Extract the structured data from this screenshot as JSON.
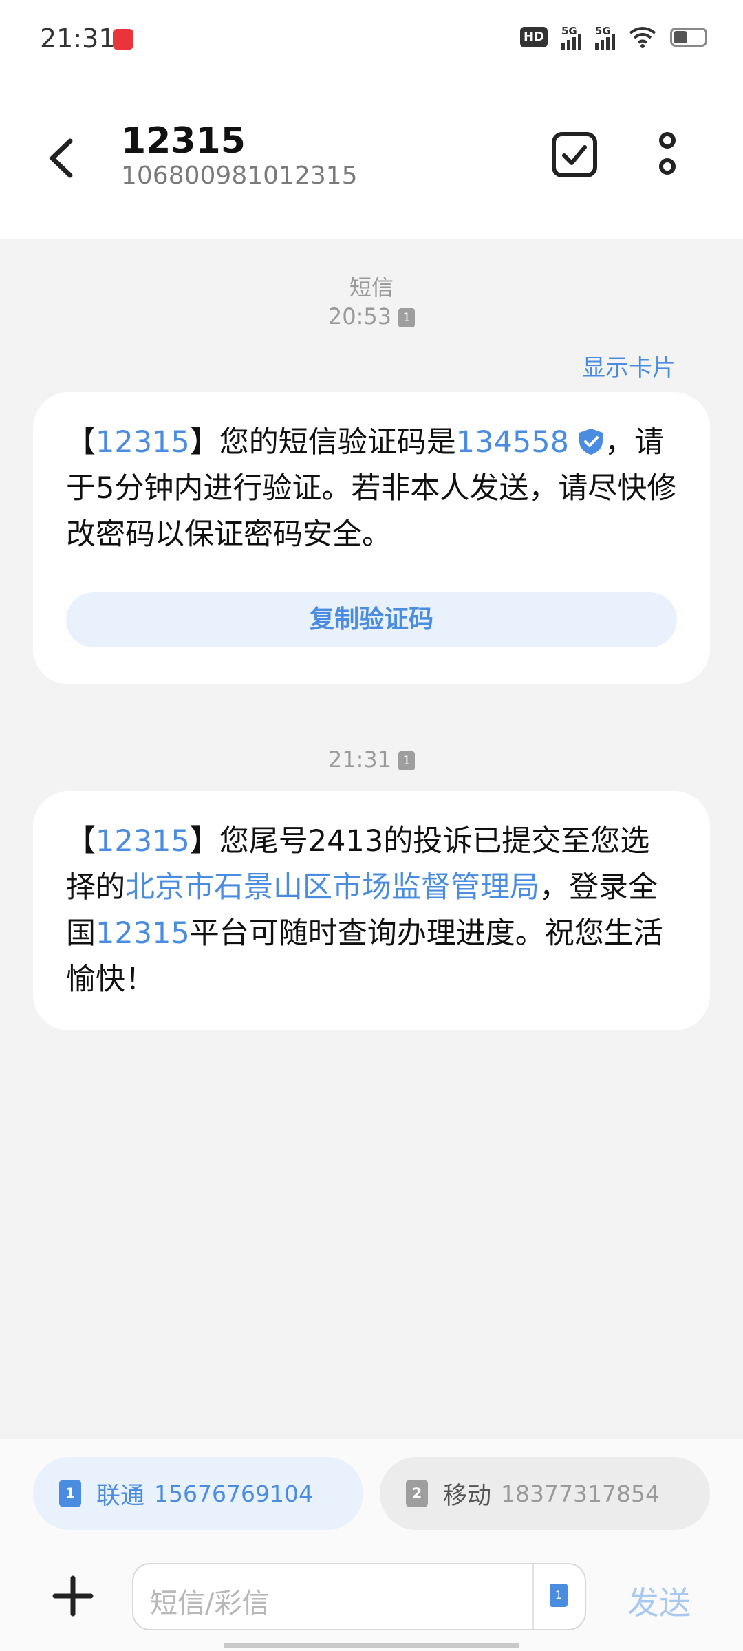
{
  "status": {
    "time": "21:31",
    "hd_label": "HD",
    "sim1_network": "5G",
    "sim2_network": "5G"
  },
  "header": {
    "contact_name": "12315",
    "contact_number": "106800981012315"
  },
  "thread": {
    "first_meta_label": "短信",
    "first_time": "20:53",
    "first_sim": "1",
    "show_card": "显示卡片",
    "message1": {
      "p1": "【",
      "link1": "12315",
      "p2": "】您的短信验证码是",
      "code": "134558",
      "p3": "，请于5分钟内进行验证。若非本人发送，请尽快修改密码以保证密码安全。",
      "copy_button": "复制验证码"
    },
    "second_time": "21:31",
    "second_sim": "1",
    "message2": {
      "p1": "【",
      "link1": "12315",
      "p2": "】您尾号2413的投诉已提交至您选择的",
      "link2": "北京市石景山区市场监督管理局",
      "p3": "，登录全国",
      "link3": "12315",
      "p4": "平台可随时查询办理进度。祝您生活愉快！"
    }
  },
  "sim_selector": {
    "sim1": {
      "index": "1",
      "carrier": "联通",
      "number": "15676769104"
    },
    "sim2": {
      "index": "2",
      "carrier": "移动",
      "number": "18377317854"
    }
  },
  "composer": {
    "placeholder": "短信/彩信",
    "sim_toggle": "1",
    "send_label": "发送"
  },
  "colors": {
    "accent": "#4a8de0",
    "background": "#f3f3f3",
    "bubble": "#ffffff"
  }
}
